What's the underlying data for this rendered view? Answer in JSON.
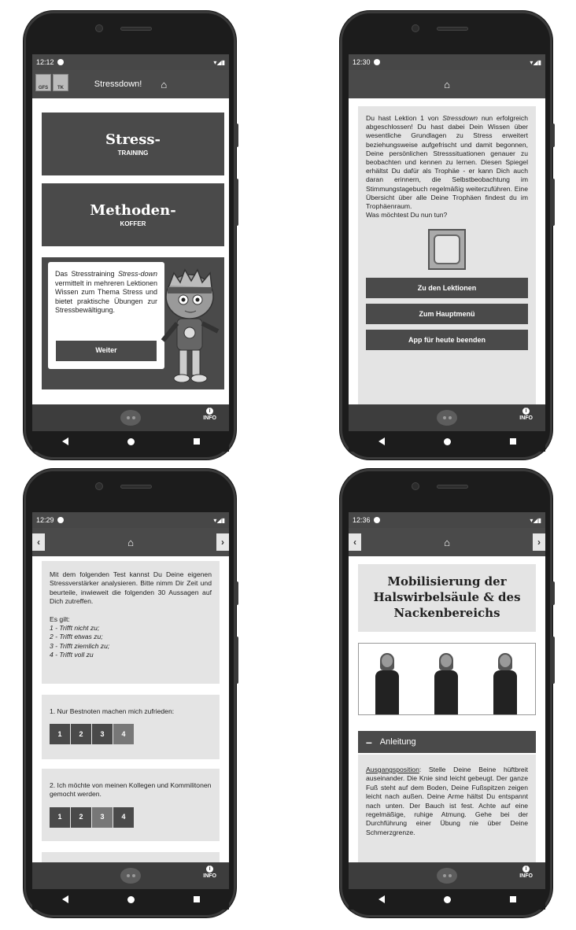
{
  "colors": {
    "dark": "#4a4a4a",
    "panel": "#e4e4e4",
    "frame": "#1c1c1c"
  },
  "phone1": {
    "status_time": "12:12",
    "app_title": "Stressdown!",
    "logos": [
      "GFS",
      "TK"
    ],
    "tile1_title": "Stress-",
    "tile1_sub": "TRAINING",
    "tile2_title": "Methoden-",
    "tile2_sub": "KOFFER",
    "bubble_text_pre": "Das Stresstraining ",
    "bubble_text_em": "Stress-down",
    "bubble_text_post": " vermittelt in mehreren Lektionen Wissen zum Thema Stress und bietet praktische Übungen zur Stressbewältigung.",
    "weiter_label": "Weiter",
    "info_label": "INFO"
  },
  "phone2": {
    "status_time": "12:30",
    "text_pre": "Du hast Lektion 1 von ",
    "text_em": "Stressdown",
    "text_post": " nun erfolgreich abgeschlossen! Du hast dabei Dein Wissen über wesentliche Grundlagen zu Stress erweitert beziehungsweise aufgefrischt und damit begonnen, Deine persönlichen Stresssituationen genauer zu beobachten und kennen zu lernen. Diesen Spiegel erhältst Du dafür als Trophäe - er kann Dich auch daran erinnern, die Selbstbeobachtung im Stimmungstagebuch regelmäßig weiterzuführen. Eine Übersicht über alle Deine Trophäen findest du im Trophäenraum.",
    "question": "Was möchtest Du nun tun?",
    "btn1": "Zu den Lektionen",
    "btn2": "Zum Hauptmenü",
    "btn3": "App für heute beenden",
    "info_label": "INFO"
  },
  "phone3": {
    "status_time": "12:29",
    "intro": "Mit dem folgenden Test kannst Du Deine eigenen Stressverstärker analysieren. Bitte nimm Dir Zeit und beurteile, inwieweit die folgenden 30 Aussagen auf Dich zutreffen.",
    "es_gilt": "Es gilt:",
    "scale1": "1 - Trifft nicht zu;",
    "scale2": "2 - Trifft etwas zu;",
    "scale3": "3 - Trifft ziemlich zu;",
    "scale4": "4 - Trifft voll zu",
    "q1": "1. Nur Bestnoten machen mich zufrieden:",
    "q2": "2. Ich möchte von meinen Kollegen und Kommilitonen gemocht werden.",
    "options": [
      "1",
      "2",
      "3",
      "4"
    ],
    "q1_selected": 4,
    "q2_selected": 3,
    "info_label": "INFO"
  },
  "phone4": {
    "status_time": "12:36",
    "title": "Mobilisierung der Halswirbelsäule & des Nackenbereichs",
    "section": "Anleitung",
    "text_u": "Ausgangsposition",
    "text_post": ": Stelle Deine Beine hüftbreit auseinander. Die Knie sind leicht gebeugt. Der ganze Fuß steht auf dem Boden, Deine Fußspitzen zeigen leicht nach außen. Deine Arme hältst Du entspannt nach unten. Der Bauch ist fest. Achte auf eine regelmäßige, ruhige Atmung. Gehe bei der Durchführung einer Übung nie über Deine Schmerzgrenze.",
    "info_label": "INFO"
  }
}
